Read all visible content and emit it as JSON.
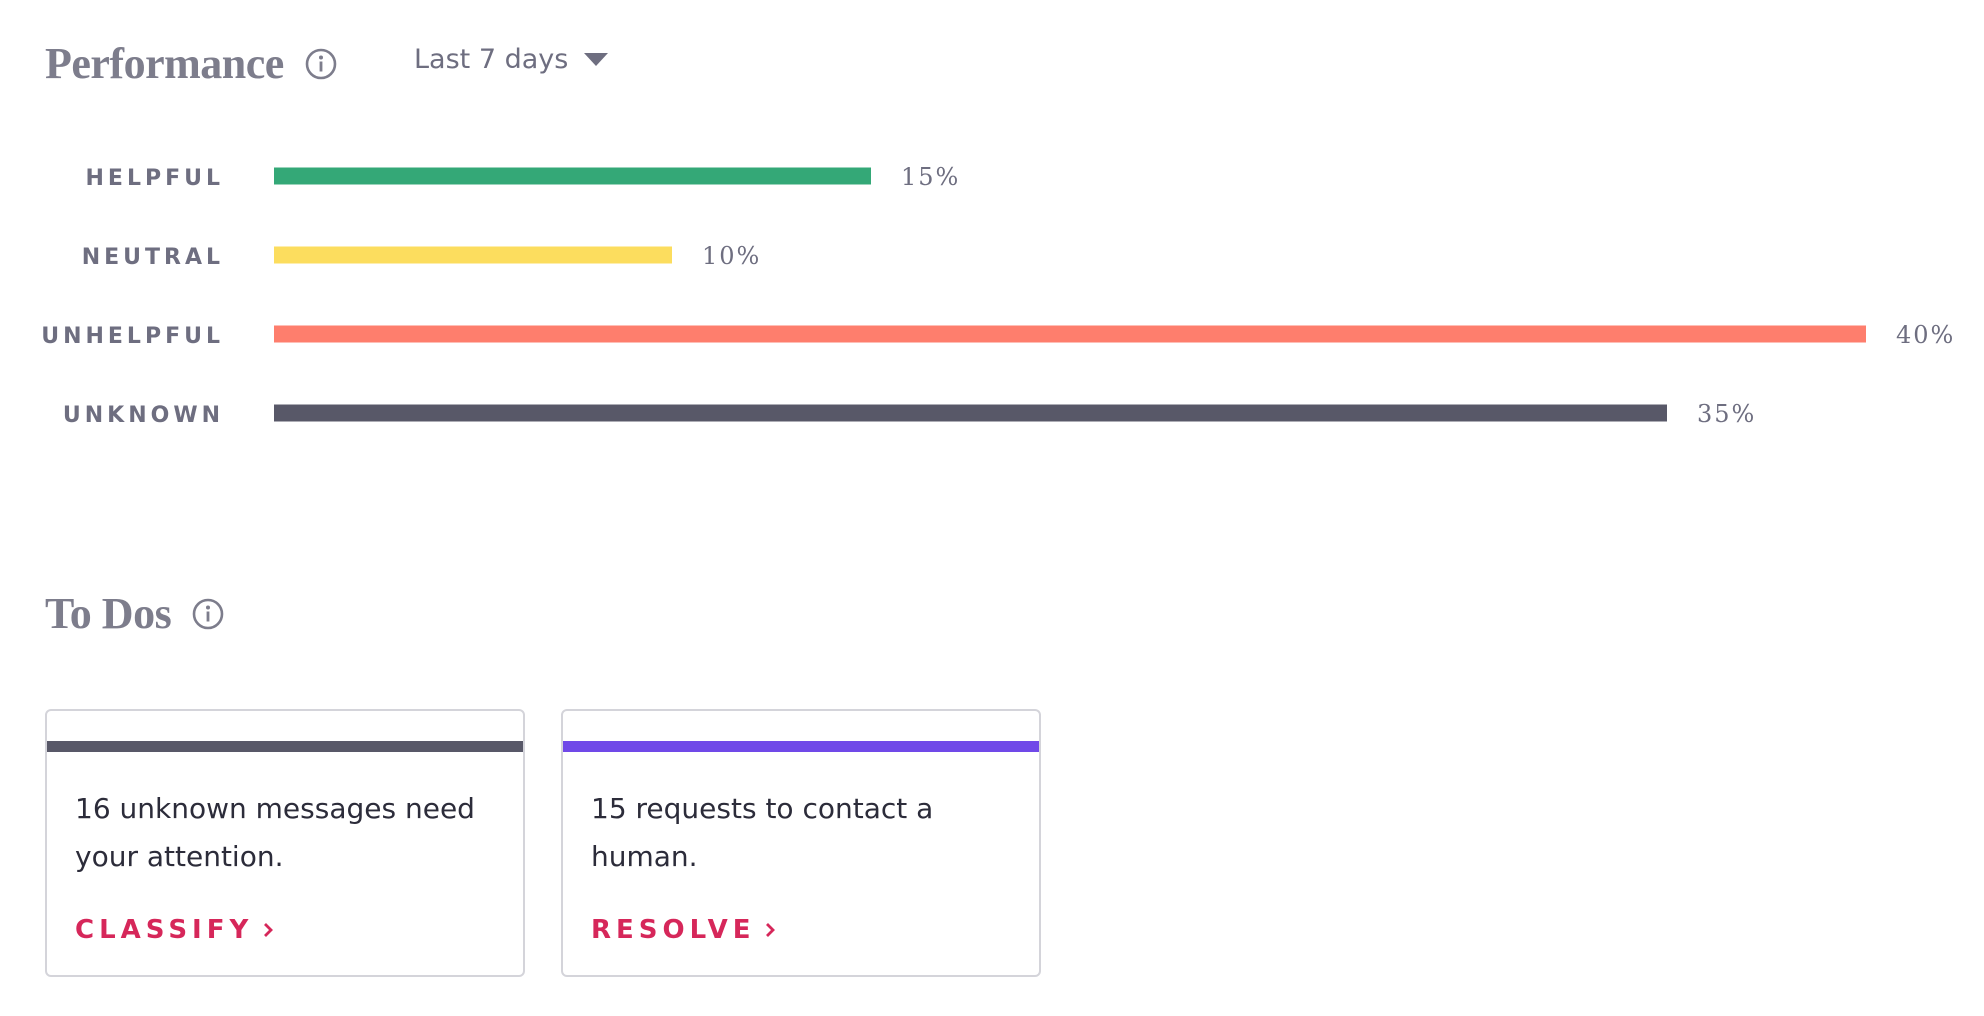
{
  "performance": {
    "title": "Performance",
    "info_icon": "info-icon",
    "range_selector": {
      "value": "Last 7 days",
      "icon": "caret-down-icon"
    }
  },
  "chart_data": {
    "type": "bar",
    "orientation": "horizontal",
    "categories": [
      "HELPFUL",
      "NEUTRAL",
      "UNHELPFUL",
      "UNKNOWN"
    ],
    "values": [
      15,
      10,
      40,
      35
    ],
    "value_labels": [
      "15%",
      "10%",
      "40%",
      "35%"
    ],
    "colors": [
      "#34a877",
      "#fcdd5e",
      "#fe7e6d",
      "#585868"
    ],
    "xlim": [
      0,
      40
    ],
    "grid": false,
    "title": "",
    "xlabel": "",
    "ylabel": ""
  },
  "todos": {
    "title": "To Dos",
    "info_icon": "info-icon",
    "cards": [
      {
        "accent": "#585868",
        "text": "16 unknown messages need your attention.",
        "action": "CLASSIFY",
        "action_icon": "chevron-right-icon"
      },
      {
        "accent": "#7049e8",
        "text": "15 requests to contact a human.",
        "action": "RESOLVE",
        "action_icon": "chevron-right-icon"
      }
    ]
  },
  "colors": {
    "title": "#7d7d8c",
    "label": "#6e6e80",
    "action": "#d6275a"
  }
}
